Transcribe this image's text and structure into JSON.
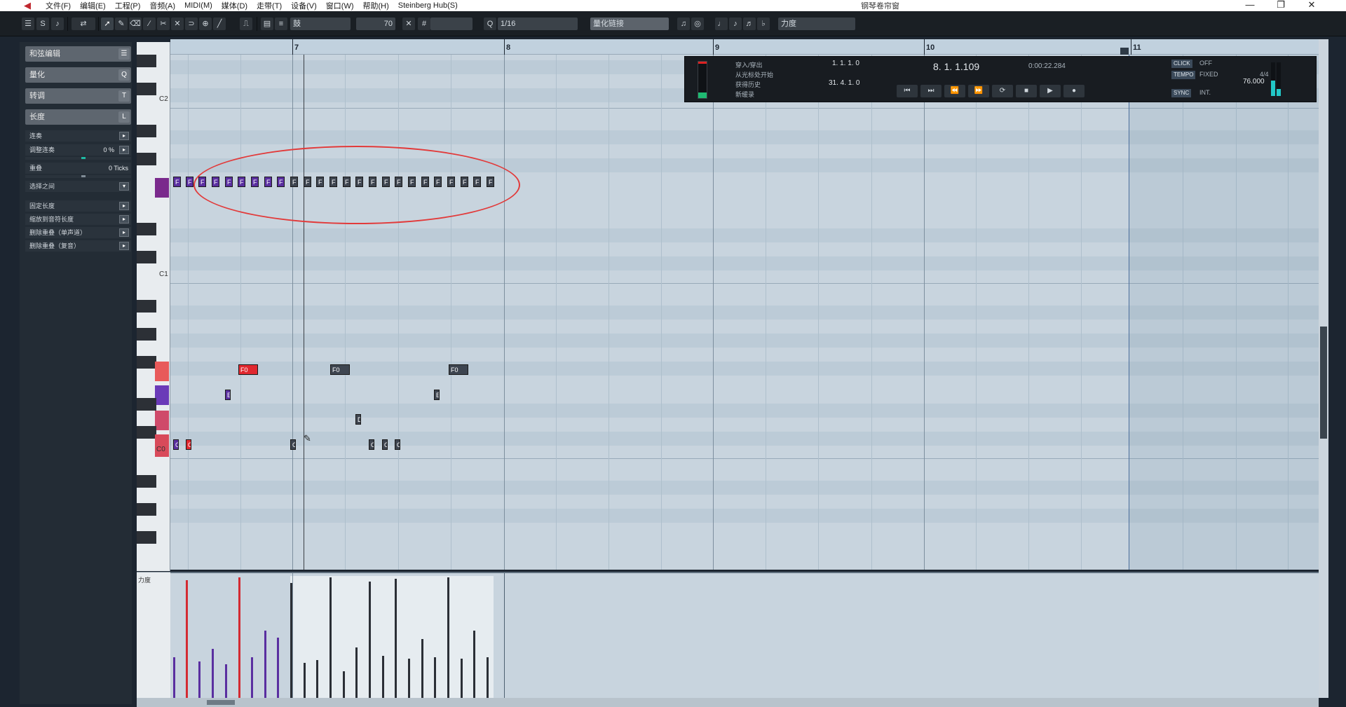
{
  "window": {
    "title": "钢琴卷帘窗",
    "menu": [
      "文件(F)",
      "编辑(E)",
      "工程(P)",
      "音频(A)",
      "MIDI(M)",
      "媒体(D)",
      "走带(T)",
      "设备(V)",
      "窗口(W)",
      "帮助(H)",
      "Steinberg Hub(S)"
    ],
    "controls": {
      "minimize": "—",
      "restore": "❐",
      "close": "✕"
    }
  },
  "toolbar": {
    "drum_field": "鼓",
    "velocity_value": "70",
    "quantize": "1/16",
    "quantize_link": "量化链接",
    "velocity_lane_label": "力度"
  },
  "inspector": {
    "sections": [
      {
        "label": "和弦编辑",
        "icon": "☰"
      },
      {
        "label": "量化",
        "icon": "Q"
      },
      {
        "label": "转调",
        "icon": "T"
      },
      {
        "label": "长度",
        "icon": "L"
      }
    ],
    "rows": [
      {
        "label": "连奏",
        "value": ""
      },
      {
        "label": "调整连奏",
        "value": "0 %"
      },
      {
        "label": "重叠",
        "value": "0 Ticks"
      },
      {
        "label": "选择之间",
        "value": ""
      },
      {
        "label": "固定长度",
        "value": ""
      },
      {
        "label": "缩放到音符长度",
        "value": ""
      },
      {
        "label": "删除重叠（单声道）",
        "value": ""
      },
      {
        "label": "删除重叠（复音）",
        "value": ""
      }
    ]
  },
  "ruler": {
    "bars": [
      "7",
      "8",
      "9",
      "10",
      "11"
    ]
  },
  "keyboard": {
    "labels": [
      "C2",
      "C1",
      "C0"
    ]
  },
  "notes": {
    "f_label": "F",
    "f0_label": "F0",
    "c_label": "C",
    "e_label": "E",
    "d_label": "D"
  },
  "transport": {
    "list": [
      "穿入/穿出",
      "从光标处开始",
      "获得历史",
      "新缓录"
    ],
    "left_locator": "1. 1. 1.   0",
    "right_locator": "31. 4. 1.   0",
    "position": "8. 1. 1.109",
    "time": "0:00:22.284",
    "click": "CLICK",
    "click_state": "OFF",
    "tempo": "TEMPO",
    "tempo_mode": "FIXED",
    "sync": "SYNC",
    "sync_mode": "INT.",
    "signature": "4/4",
    "bpm": "76.000"
  },
  "velocity_lane": {
    "label": "力度"
  },
  "colors": {
    "accent_red": "#e0282f",
    "accent_purple": "#5a2fa0",
    "annotation_circle": "#e23a3a"
  }
}
